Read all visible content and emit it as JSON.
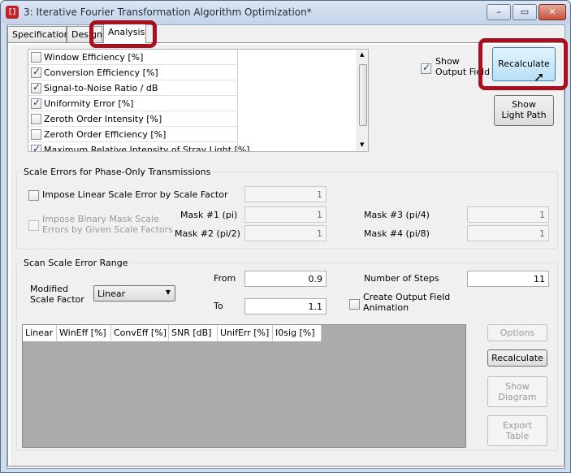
{
  "window": {
    "icon_text": "⟦⟧",
    "title": "3: Iterative Fourier Transformation Algorithm Optimization*",
    "controls": [
      "minimize",
      "maximize",
      "close"
    ]
  },
  "tabs": [
    {
      "label": "Specification"
    },
    {
      "label": "Design"
    },
    {
      "label": "Analysis"
    }
  ],
  "merit_list": {
    "items": [
      {
        "label": "Window Efficiency [%]",
        "checked": false
      },
      {
        "label": "Conversion Efficiency [%]",
        "checked": true
      },
      {
        "label": "Signal-to-Noise Ratio / dB",
        "checked": true
      },
      {
        "label": "Uniformity Error [%]",
        "checked": true
      },
      {
        "label": "Zeroth Order Intensity [%]",
        "checked": false
      },
      {
        "label": "Zeroth Order Efficiency [%]",
        "checked": false
      },
      {
        "label": "Maximum Relative Intensity of Stray Light [%]",
        "checked": true
      }
    ]
  },
  "show_output_field": {
    "label_line1": "Show",
    "label_line2": "Output Field",
    "checked": true
  },
  "buttons": {
    "recalculate_top": "Recalculate",
    "show_light_path_1": "Show",
    "show_light_path_2": "Light Path",
    "options": "Options",
    "recalculate_bottom": "Recalculate",
    "show_diagram_1": "Show",
    "show_diagram_2": "Diagram",
    "export_table_1": "Export",
    "export_table_2": "Table"
  },
  "scale_errors": {
    "title": "Scale Errors for Phase-Only Transmissions",
    "impose_linear_label": "Impose Linear Scale Error by Scale Factor",
    "scale_factor_value": "1",
    "impose_binary_line1": "Impose Binary Mask Scale",
    "impose_binary_line2": "Errors by Given Scale Factors",
    "mask1_label": "Mask #1 (pi)",
    "mask1_value": "1",
    "mask2_label": "Mask #2 (pi/2)",
    "mask2_value": "1",
    "mask3_label": "Mask #3 (pi/4)",
    "mask3_value": "1",
    "mask4_label": "Mask #4 (pi/8)",
    "mask4_value": "1"
  },
  "scan": {
    "title": "Scan Scale Error Range",
    "modified_line1": "Modified",
    "modified_line2": "Scale Factor",
    "mode_selected": "Linear",
    "from_label": "From",
    "from_value": "0.9",
    "to_label": "To",
    "to_value": "1.1",
    "steps_label": "Number of Steps",
    "steps_value": "11",
    "animation_line1": "Create Output Field",
    "animation_line2": "Animation",
    "animation_checked": false
  },
  "results_table": {
    "columns": [
      "Linear",
      "WinEff [%]",
      "ConvEff [%]",
      "SNR [dB]",
      "UnifErr [%]",
      "I0sig [%]"
    ],
    "rows": []
  },
  "highlight_color": "#a81020"
}
